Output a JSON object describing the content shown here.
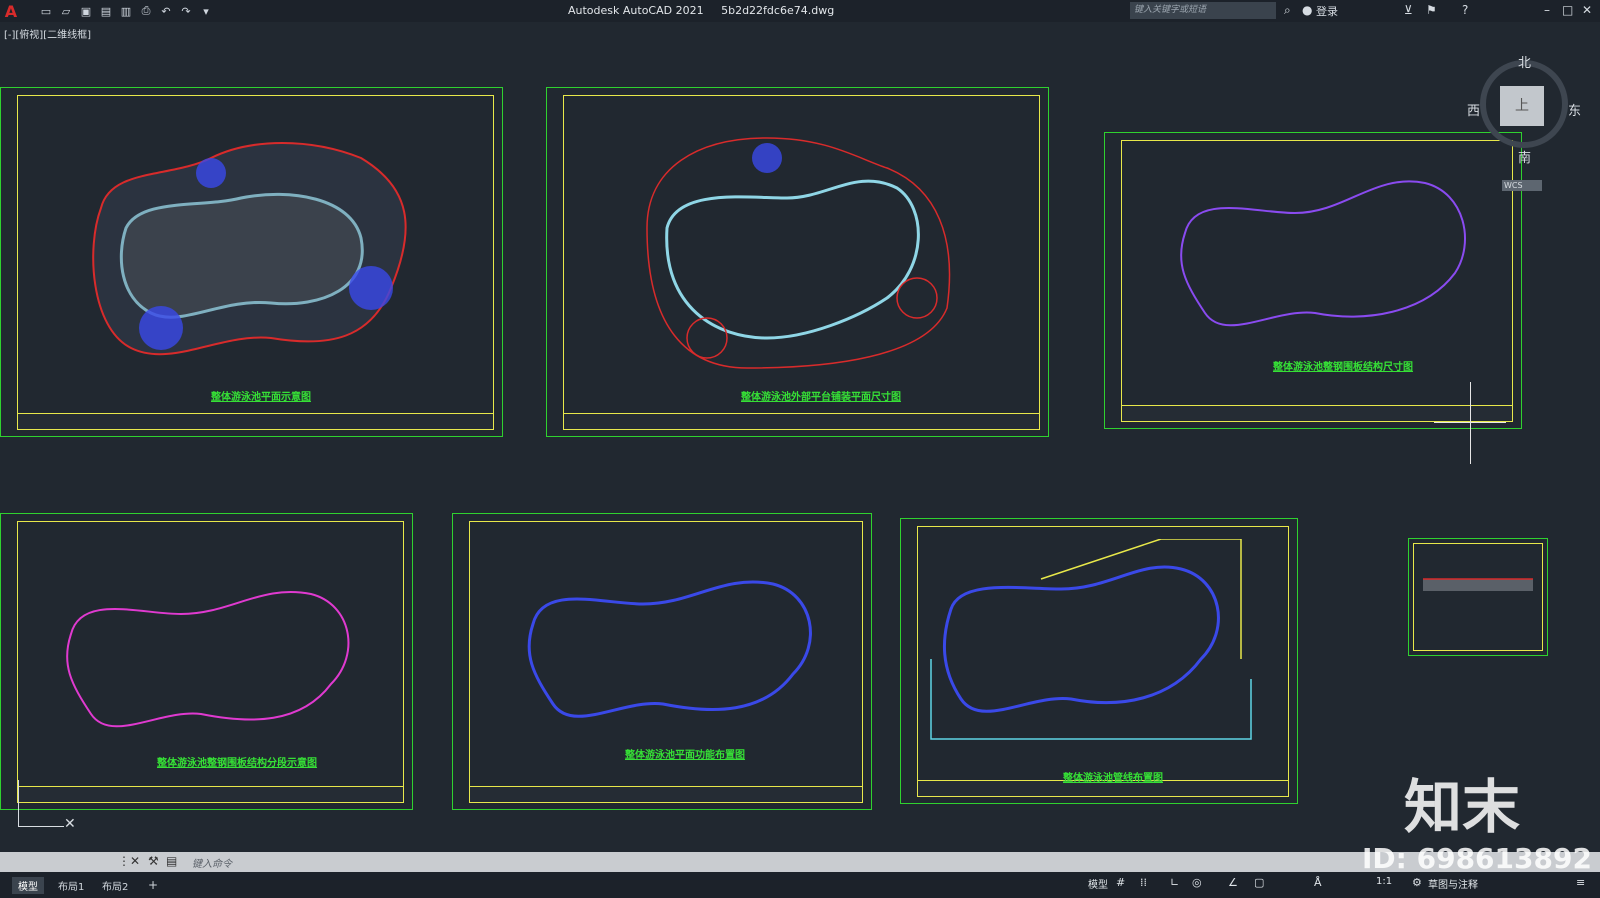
{
  "app": {
    "title": "Autodesk AutoCAD 2021",
    "file": "5b2d22fdc6e74.dwg",
    "search_placeholder": "键入关键字或短语",
    "login": "登录"
  },
  "viewport": {
    "label": "[-][俯视][二维线框]"
  },
  "viewcube": {
    "north": "北",
    "south": "南",
    "east": "东",
    "west": "西",
    "top": "上",
    "wcs": "WCS"
  },
  "sheets": [
    {
      "title": "整体游泳池平面示意图"
    },
    {
      "title": "整体游泳池外部平台铺装平面尺寸图"
    },
    {
      "title": "整体游泳池整钢围板结构尺寸图"
    },
    {
      "title": "整体游泳池整钢围板结构分段示意图"
    },
    {
      "title": "整体游泳池平面功能布置图"
    },
    {
      "title": "整体游泳池管线布置图"
    },
    {
      "title": ""
    }
  ],
  "command": {
    "placeholder": "键入命令"
  },
  "tabs": [
    {
      "label": "模型"
    },
    {
      "label": "布局1"
    },
    {
      "label": "布局2"
    }
  ],
  "status": {
    "model": "模型",
    "scale": "1:1",
    "workspace": "草图与注释"
  },
  "watermark": {
    "brand": "知末",
    "id": "ID: 698613892"
  },
  "colors": {
    "frame": "#2fd12f",
    "border": "#e8e84a",
    "pool": "#3a49e8",
    "accent": "#d82b2b"
  }
}
